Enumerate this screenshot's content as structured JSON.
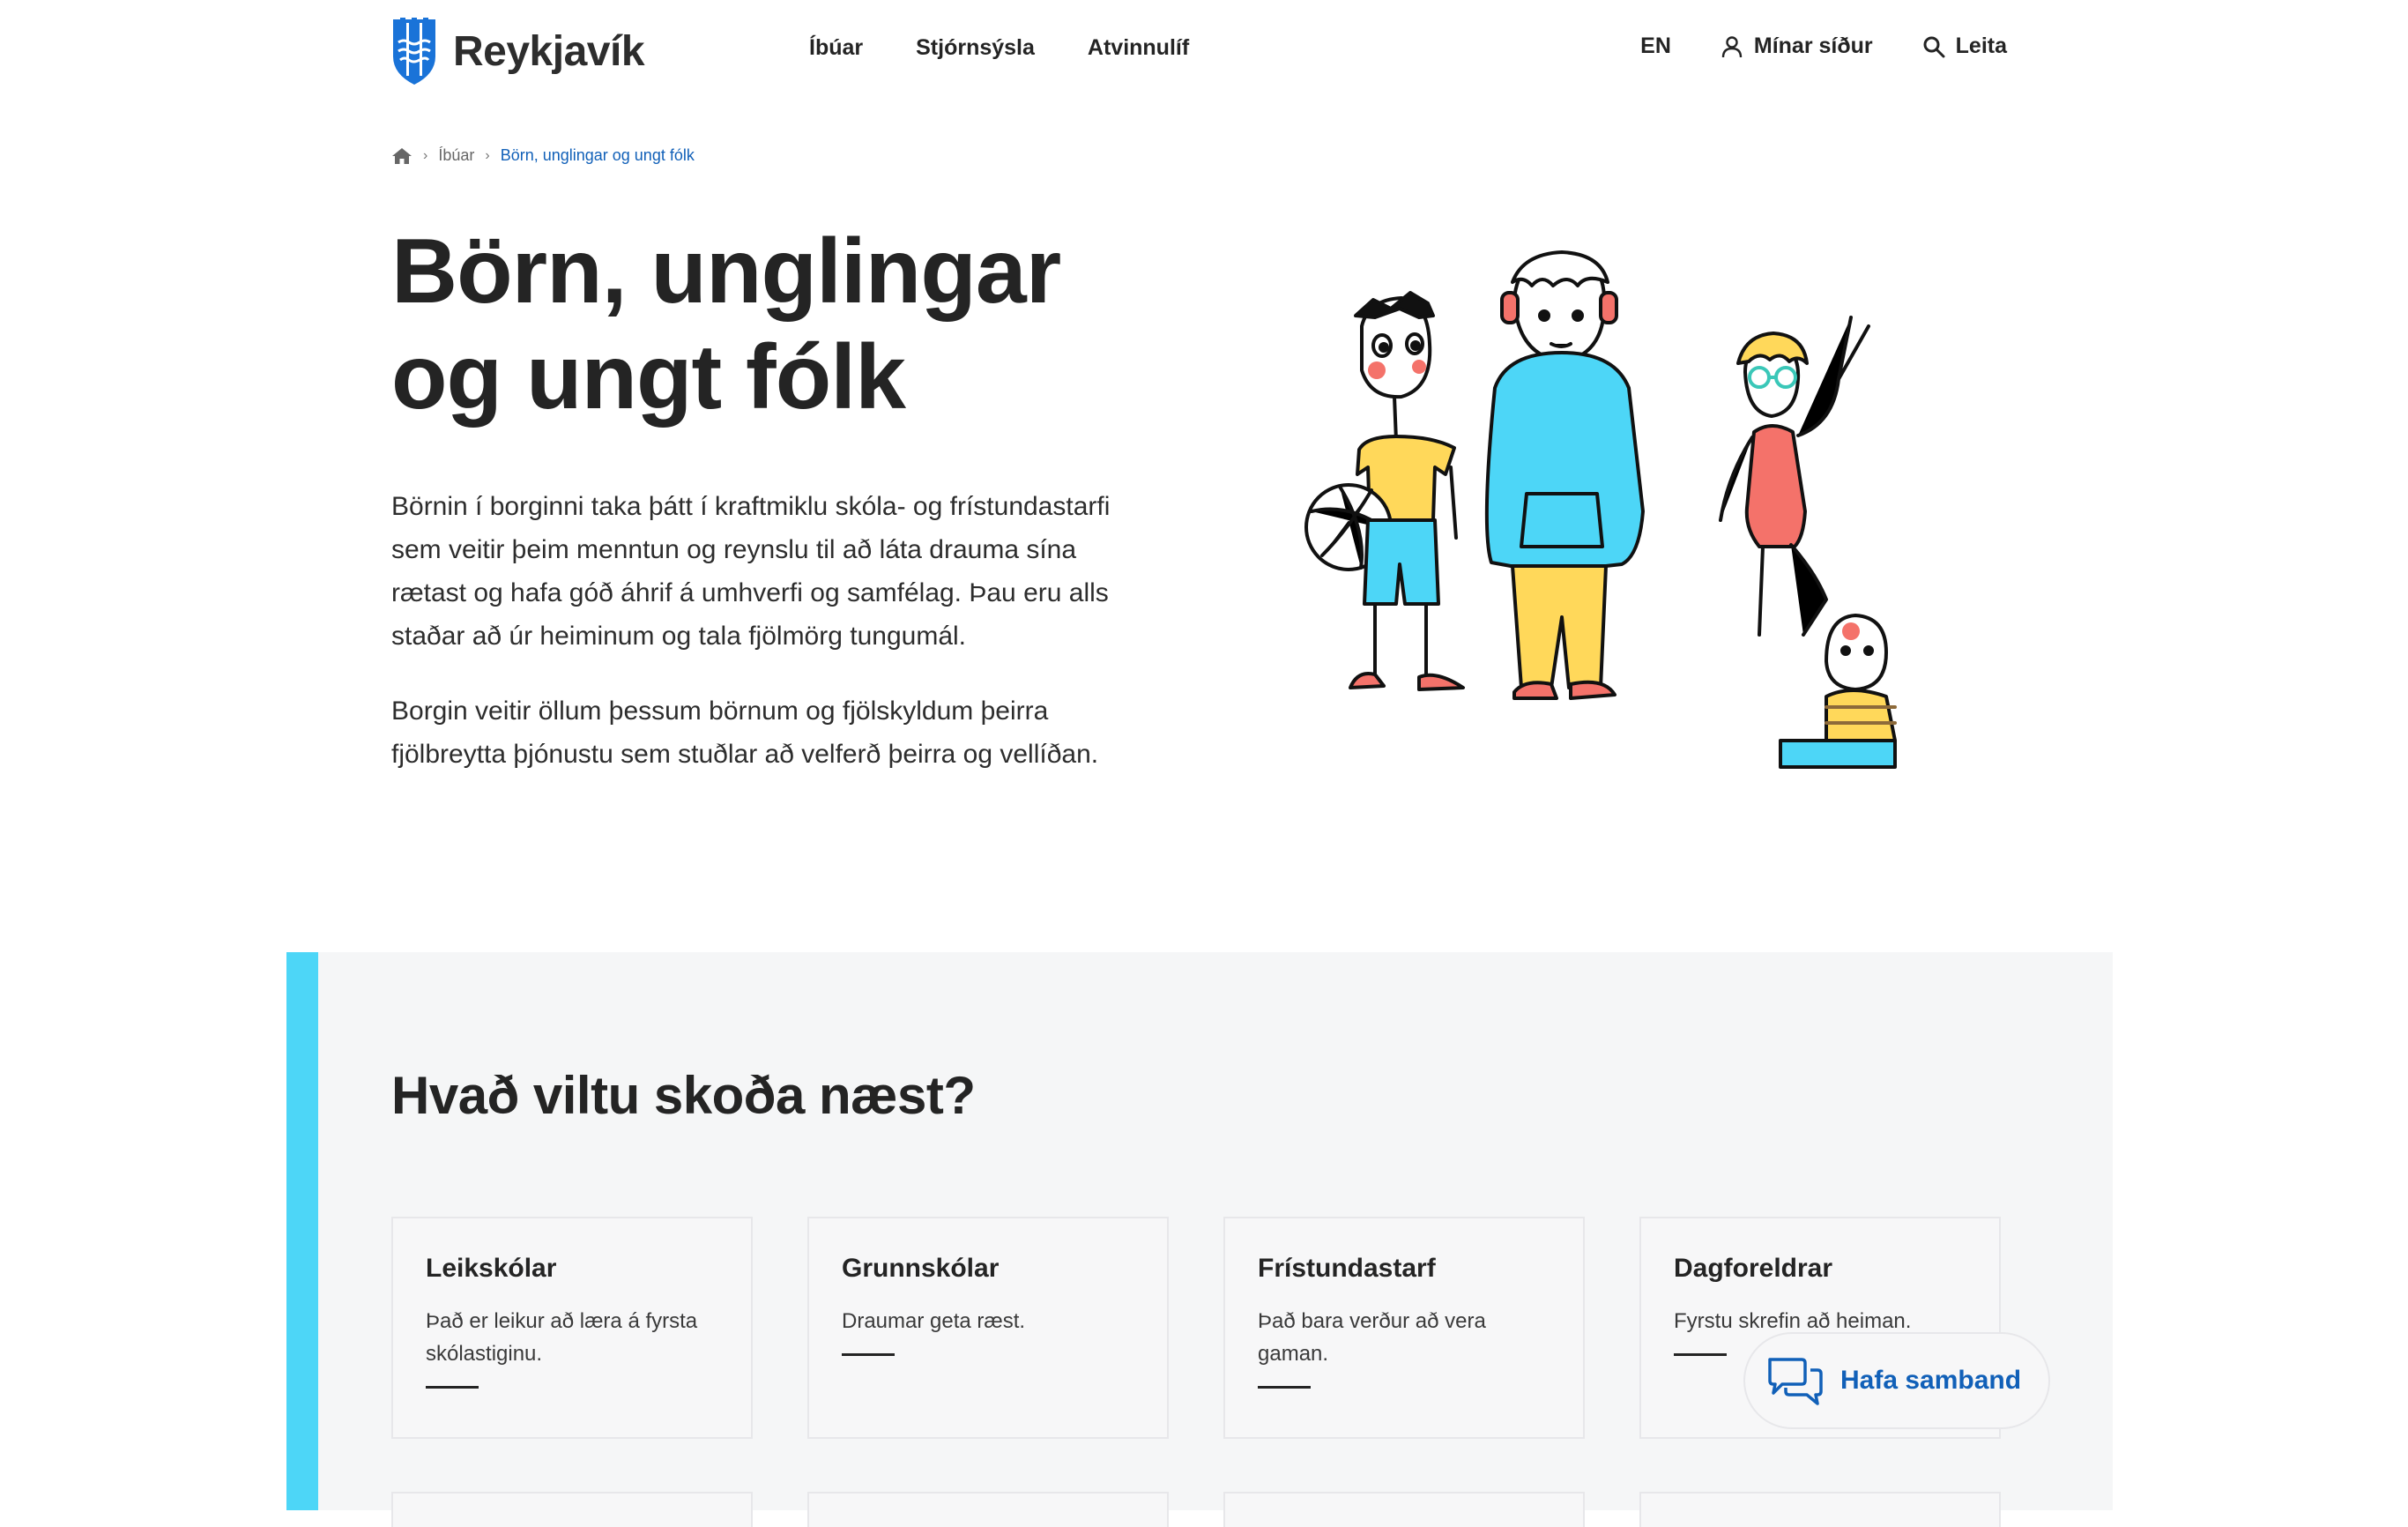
{
  "header": {
    "logo_text": "Reykjavík",
    "main_nav": [
      "Íbúar",
      "Stjórnsýsla",
      "Atvinnulíf"
    ],
    "lang_label": "EN",
    "account_label": "Mínar síður",
    "search_label": "Leita"
  },
  "breadcrumb": {
    "items": [
      "Íbúar",
      "Börn, unglingar og ungt fólk"
    ]
  },
  "page": {
    "title": "Börn, unglingar og ungt fólk",
    "intro_paragraphs": [
      "Börnin í borginni taka þátt í kraftmiklu skóla- og frístundastarfi sem veitir þeim menntun og reynslu til að láta drauma sína rætast og hafa góð áhrif á umhverfi og samfélag. Þau eru alls staðar að úr heiminum og tala fjölmörg tungumál.",
      "Borgin veitir öllum þessum börnum og fjölskyldum þeirra fjölbreytta þjónustu sem stuðlar að velferð þeirra og vellíðan."
    ]
  },
  "next": {
    "heading": "Hvað viltu skoða næst?",
    "cards": [
      {
        "title": "Leikskólar",
        "desc": "Það er leikur að læra á fyrsta skólastiginu."
      },
      {
        "title": "Grunnskólar",
        "desc": "Draumar geta ræst."
      },
      {
        "title": "Frístundastarf",
        "desc": "Það bara verður að vera gaman."
      },
      {
        "title": "Dagforeldrar",
        "desc": "Fyrstu skrefin að heiman."
      }
    ]
  },
  "contact": {
    "label": "Hafa samband"
  },
  "colors": {
    "accent": "#4dd6f7",
    "link": "#1160b8",
    "brand_blue": "#1a73d8"
  }
}
